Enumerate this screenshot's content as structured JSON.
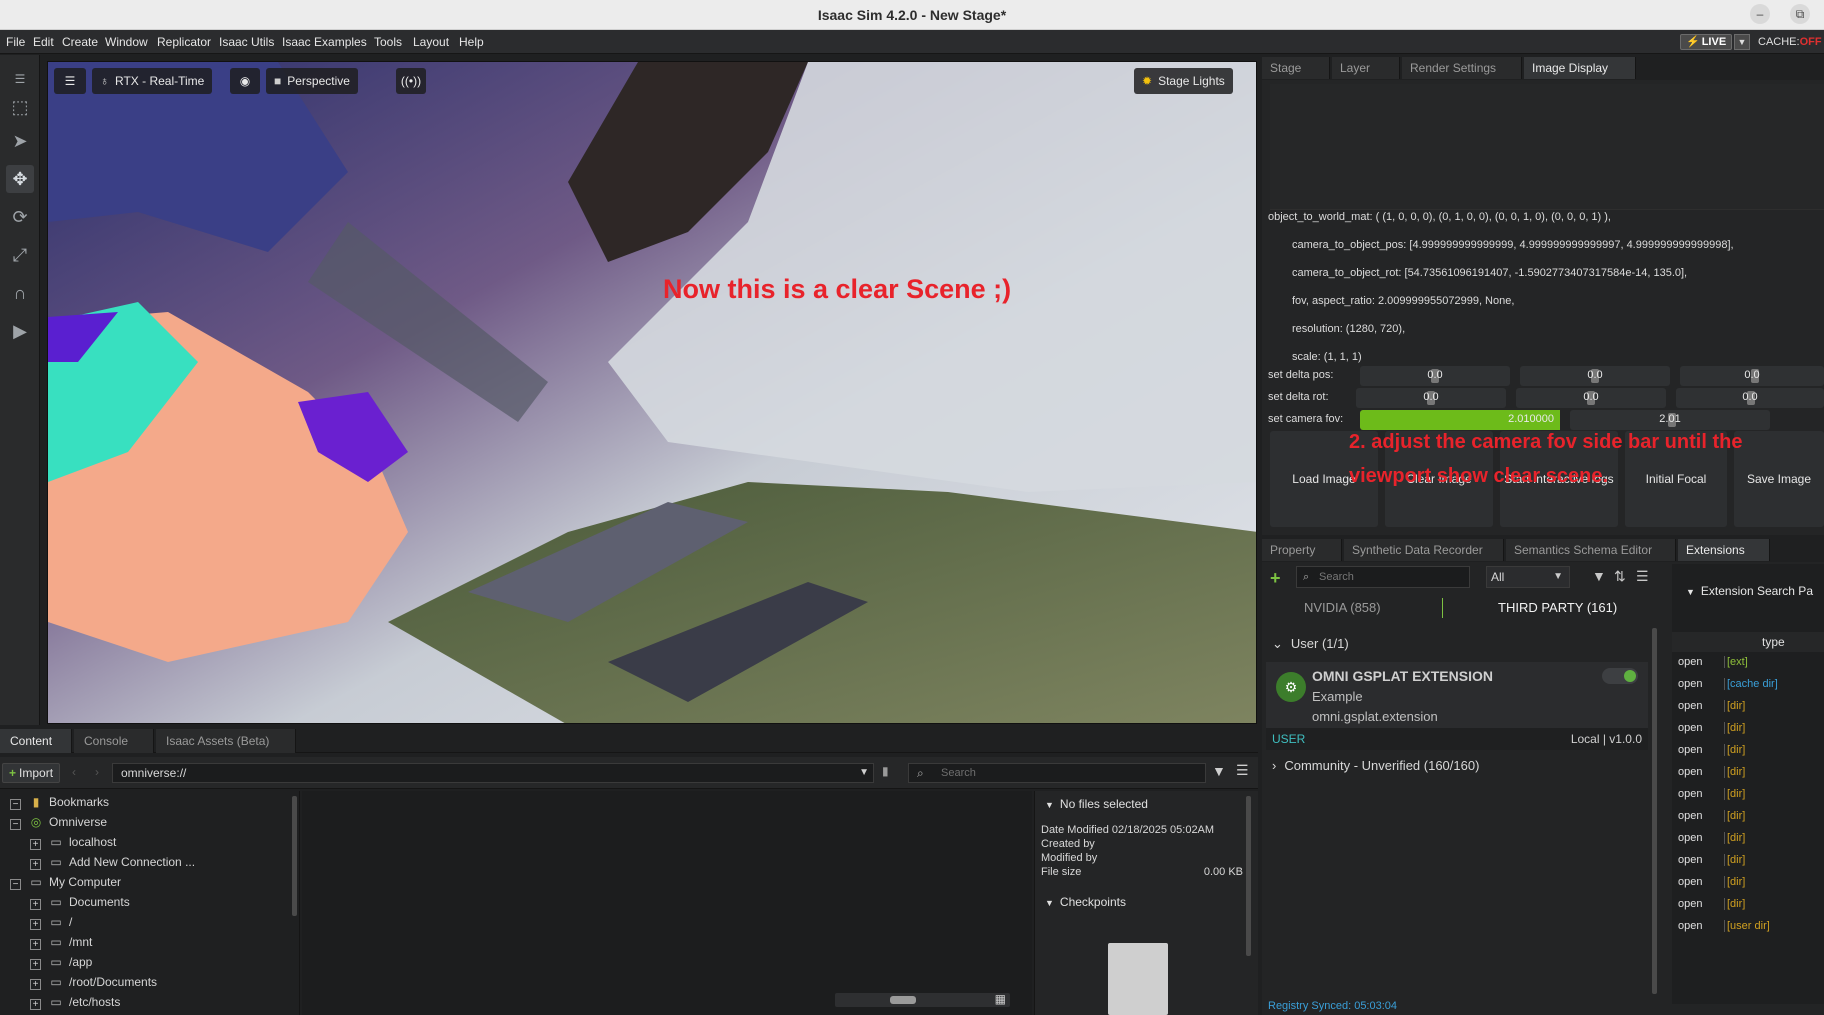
{
  "window": {
    "title": "Isaac Sim 4.2.0 - New Stage*",
    "minimize": "–",
    "maximize": "⧉"
  },
  "menu": {
    "items": [
      "File",
      "Edit",
      "Create",
      "Window",
      "Replicator",
      "Isaac Utils",
      "Isaac Examples",
      "Tools",
      "Layout",
      "Help"
    ],
    "live": "LIVE",
    "cache_label": "CACHE:",
    "cache_state": "OFF"
  },
  "viewport": {
    "renderer": "RTX - Real-Time",
    "camera": "Perspective",
    "stage_lights": "Stage Lights",
    "annotation": "Now this is a clear Scene ;)"
  },
  "content_panel": {
    "tabs": [
      "Content",
      "Console",
      "Isaac Assets (Beta)"
    ],
    "import_label": "Import",
    "path": "omniverse://",
    "search_placeholder": "Search",
    "tree": [
      {
        "label": "Bookmarks"
      },
      {
        "label": "Omniverse"
      },
      {
        "label": "localhost"
      },
      {
        "label": "Add New Connection ..."
      },
      {
        "label": "My Computer"
      },
      {
        "label": "Documents"
      },
      {
        "label": "/"
      },
      {
        "label": "/mnt"
      },
      {
        "label": "/app"
      },
      {
        "label": "/root/Documents"
      },
      {
        "label": "/etc/hosts"
      }
    ],
    "info": {
      "no_files": "No files selected",
      "date_modified": "Date Modified 02/18/2025 05:02AM",
      "created_by": "Created by",
      "modified_by": "Modified by",
      "file_size_label": "File size",
      "file_size": "0.00 KB",
      "checkpoints": "Checkpoints"
    }
  },
  "right_top": {
    "tabs": [
      "Stage",
      "Layer",
      "Render Settings",
      "Image Display"
    ],
    "lines": [
      "object_to_world_mat: ( (1, 0, 0, 0), (0, 1, 0, 0), (0, 0, 1, 0), (0, 0, 0, 1) ),",
      "camera_to_object_pos: [4.999999999999999, 4.999999999999997, 4.999999999999998],",
      "camera_to_object_rot: [54.73561096191407, -1.5902773407317584e-14, 135.0],",
      "fov, aspect_ratio: 2.009999955072999, None,",
      "resolution: (1280, 720),",
      "scale: (1, 1, 1)"
    ],
    "delta_pos_label": "set delta pos:",
    "delta_rot_label": "set delta rot:",
    "fov_label": "set camera fov:",
    "slider_zero": "0.0",
    "fov_value": "2.010000",
    "fov_value2": "2.01",
    "buttons": [
      "Load Image",
      "Clear Image",
      "Start Interactive logs",
      "Initial Focal",
      "Save Image"
    ],
    "annotation": "2. adjust the camera fov side bar until the viewport show clear scene."
  },
  "extensions": {
    "tabs": [
      "Property",
      "Synthetic Data Recorder",
      "Semantics Schema Editor",
      "Extensions"
    ],
    "search_placeholder": "Search",
    "filter": "All",
    "source_nvidia": "NVIDIA (858)",
    "source_third": "THIRD PARTY (161)",
    "group_user": "User (1/1)",
    "group_community": "Community - Unverified (160/160)",
    "card": {
      "name": "OMNI GSPLAT EXTENSION",
      "subtitle": "Example",
      "package": "omni.gsplat.extension",
      "badge": "USER",
      "version": "Local | v1.0.0"
    },
    "registry": "Registry Synced: 05:03:04",
    "side": {
      "header": "Extension Search Pa",
      "type_col": "type",
      "rows": [
        {
          "op": "open",
          "type": "[ext]"
        },
        {
          "op": "open",
          "type": "[cache dir]"
        },
        {
          "op": "open",
          "type": "[dir]"
        },
        {
          "op": "open",
          "type": "[dir]"
        },
        {
          "op": "open",
          "type": "[dir]"
        },
        {
          "op": "open",
          "type": "[dir]"
        },
        {
          "op": "open",
          "type": "[dir]"
        },
        {
          "op": "open",
          "type": "[dir]"
        },
        {
          "op": "open",
          "type": "[dir]"
        },
        {
          "op": "open",
          "type": "[dir]"
        },
        {
          "op": "open",
          "type": "[dir]"
        },
        {
          "op": "open",
          "type": "[dir]"
        },
        {
          "op": "open",
          "type": "[user dir]"
        }
      ]
    }
  }
}
